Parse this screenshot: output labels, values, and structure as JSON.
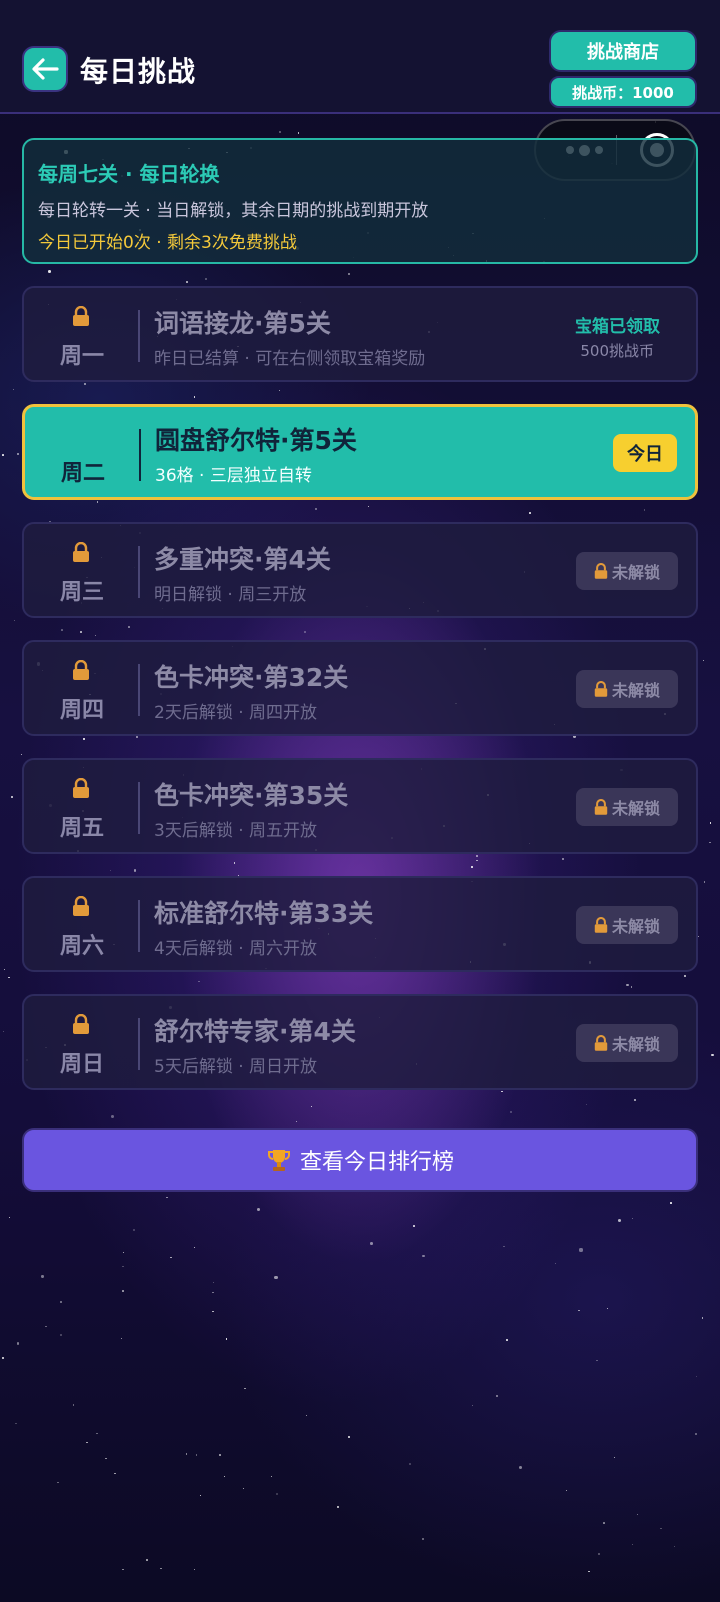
{
  "header": {
    "title": "每日挑战",
    "back_icon": "arrow-left-icon",
    "shop_button": "挑战商店",
    "coins_label": "挑战币：1000"
  },
  "capsule": {
    "menu_icon": "more-dots-icon",
    "close_icon": "target-circle-icon"
  },
  "info": {
    "title": "每周七关 · 每日轮换",
    "desc": "每日轮转一关 · 当日解锁，其余日期的挑战到期开放",
    "status": "今日已开始0次 · 剩余3次免费挑战"
  },
  "days": [
    {
      "day": "周一",
      "level": "词语接龙·第5关",
      "sub": "昨日已结算 · 可在右侧领取宝箱奖励",
      "state": "claimed",
      "claimed_title": "宝箱已领取",
      "claimed_sub": "500挑战币"
    },
    {
      "day": "周二",
      "level": "圆盘舒尔特·第5关",
      "sub": "36格 · 三层独立自转",
      "state": "today",
      "badge": "今日"
    },
    {
      "day": "周三",
      "level": "多重冲突·第4关",
      "sub": "明日解锁 · 周三开放",
      "state": "locked",
      "badge": "未解锁"
    },
    {
      "day": "周四",
      "level": "色卡冲突·第32关",
      "sub": "2天后解锁 · 周四开放",
      "state": "locked",
      "badge": "未解锁"
    },
    {
      "day": "周五",
      "level": "色卡冲突·第35关",
      "sub": "3天后解锁 · 周五开放",
      "state": "locked",
      "badge": "未解锁"
    },
    {
      "day": "周六",
      "level": "标准舒尔特·第33关",
      "sub": "4天后解锁 · 周六开放",
      "state": "locked",
      "badge": "未解锁"
    },
    {
      "day": "周日",
      "level": "舒尔特专家·第4关",
      "sub": "5天后解锁 · 周日开放",
      "state": "locked",
      "badge": "未解锁"
    }
  ],
  "leaderboard": {
    "icon": "trophy-icon",
    "label": "查看今日排行榜"
  },
  "colors": {
    "accent": "#22bdaa",
    "today_border": "#f0c23c",
    "today_badge": "#f7cf2f",
    "status_text": "#f4c93a",
    "leaderboard_button": "#6a55e0"
  }
}
